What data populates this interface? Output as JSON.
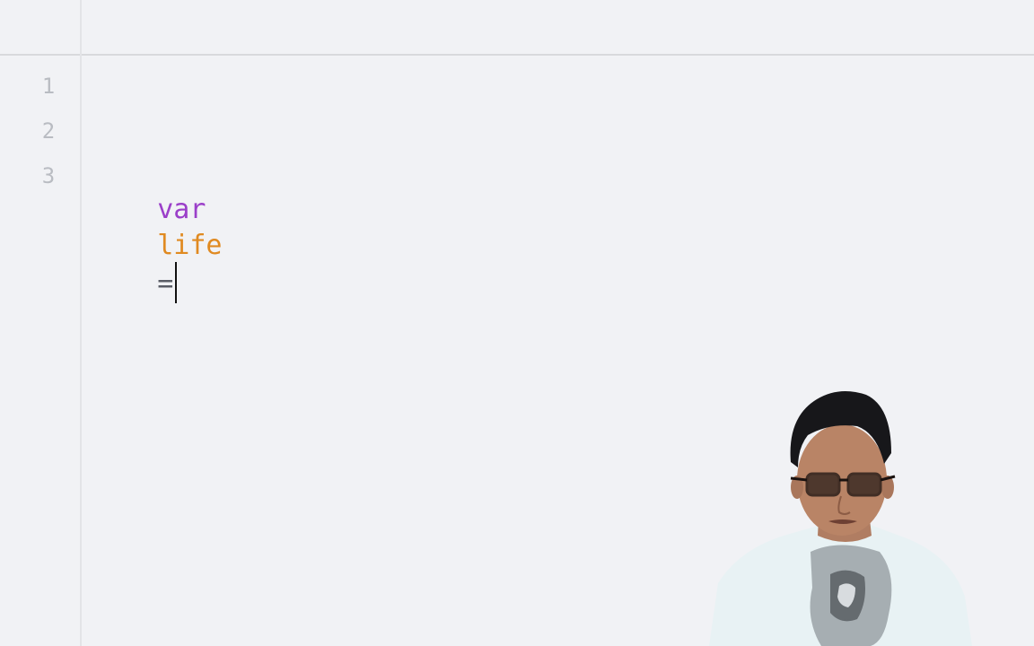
{
  "editor": {
    "line_numbers": [
      "1",
      "2",
      "3"
    ],
    "code": {
      "keyword": "var",
      "identifier": "life",
      "operator": "="
    }
  },
  "colors": {
    "background": "#f1f2f5",
    "keyword": "#9b3fc9",
    "identifier": "#e08a21",
    "line_number": "#b9bcc2"
  },
  "webcam": {
    "icon": "presenter-webcam-overlay"
  }
}
